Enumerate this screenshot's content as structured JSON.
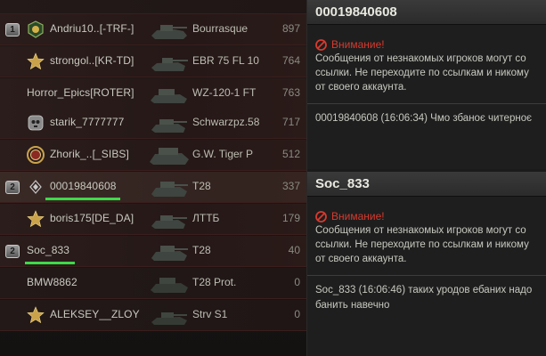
{
  "players": [
    {
      "platoon": "",
      "name": "",
      "tank": "",
      "score": ""
    },
    {
      "platoon": "1",
      "badge": "rank-emblem-icon",
      "name": "Andriu10..[-TRF-]",
      "tank": "Bourrasque",
      "score": "897"
    },
    {
      "platoon": "",
      "badge": "star-medal-icon",
      "name": "strongol..[KR-TD]",
      "tank": "EBR 75 FL 10",
      "score": "764"
    },
    {
      "platoon": "",
      "badge": "",
      "name": "Horror_Epics[ROTER]",
      "tank": "WZ-120-1 FT",
      "score": "763"
    },
    {
      "platoon": "",
      "badge": "skull-badge-icon",
      "name": "starik_7777777",
      "tank": "Schwarzpz.58",
      "score": "717"
    },
    {
      "platoon": "",
      "badge": "wreath-medal-icon",
      "name": "Zhorik_..[_SIBS]",
      "tank": "G.W. Tiger P",
      "score": "512"
    },
    {
      "platoon": "2",
      "badge": "diamond-rank-icon",
      "name": "00019840608",
      "tank": "T28",
      "score": "337",
      "underline": true
    },
    {
      "platoon": "",
      "badge": "star-medal-icon",
      "name": "boris175[DE_DA]",
      "tank": "ЛТТБ",
      "score": "179"
    },
    {
      "platoon": "2",
      "badge": "",
      "name": "Soc_833",
      "tank": "T28",
      "score": "40",
      "underline": true
    },
    {
      "platoon": "",
      "badge": "",
      "name": "BMW8862",
      "tank": "T28 Prot.",
      "score": "0"
    },
    {
      "platoon": "",
      "badge": "star-medal-icon",
      "name": "ALEKSEY__ZLOY",
      "tank": "Strv S1",
      "score": "0"
    }
  ],
  "chats": [
    {
      "title": "00019840608",
      "warning_title": "Внимание!",
      "warning_lines": [
        "Сообщения от незнакомых игроков могут со",
        "ссылки. Не переходите по ссылкам и никому",
        "от своего аккаунта."
      ],
      "message": "00019840608 (16:06:34) Чмо збаноє читерноє"
    },
    {
      "title": "Soc_833",
      "warning_title": "Внимание!",
      "warning_lines": [
        "Сообщения от незнакомых игроков могут со",
        "ссылки. Не переходите по ссылкам и никому",
        "от своего аккаунта."
      ],
      "message": "Soc_833 (16:06:46) таких уродов ебаних надо банить навечно"
    }
  ],
  "colors": {
    "warning": "#d63a2e",
    "underline": "#3fd94a"
  }
}
